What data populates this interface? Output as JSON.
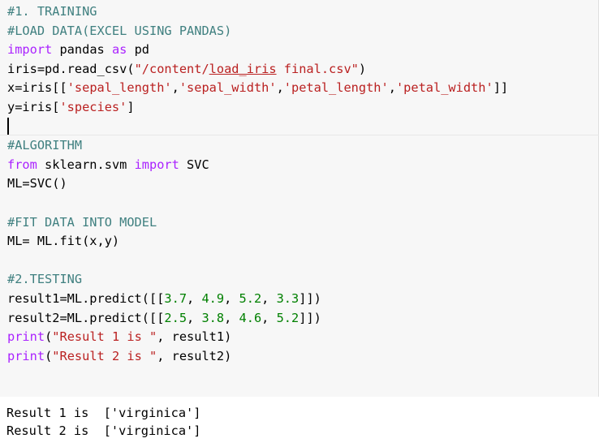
{
  "code_cell": {
    "comment_training": "#1. TRAINING",
    "comment_load": "#LOAD DATA(EXCEL USING PANDAS)",
    "kw_import": "import",
    "txt_pandas": " pandas ",
    "kw_as": "as",
    "txt_pd": " pd",
    "read_prefix": "iris=pd.read_csv(",
    "read_path_a": "\"/content/",
    "read_path_b": "load_iris",
    "read_path_c": " final.csv\"",
    "read_suffix": ")",
    "x_prefix": "x=iris[[",
    "col1": "'sepal_length'",
    "comma": ",",
    "col2": "'sepal_width'",
    "col3": "'petal_length'",
    "col4": "'petal_width'",
    "x_suffix": "]]",
    "y_prefix": "y=iris[",
    "y_col": "'species'",
    "y_suffix": "]",
    "comment_algorithm": "#ALGORITHM",
    "kw_from": "from",
    "txt_sklearn": " sklearn.svm ",
    "txt_svc": " SVC",
    "ml_svc": "ML=SVC()",
    "comment_fit": "#FIT DATA INTO MODEL",
    "ml_fit": "ML= ML.fit(x,y)",
    "comment_testing": "#2.TESTING",
    "r1_prefix": "result1=ML.predict([[",
    "r1_a": "3.7",
    "r1_b": "4.9",
    "r1_c": "5.2",
    "r1_d": "3.3",
    "r2_prefix": "result2=ML.predict([[",
    "r2_a": "2.5",
    "r2_b": "3.8",
    "r2_c": "4.6",
    "r2_d": "5.2",
    "num_sep": ", ",
    "predict_suffix": "]])",
    "kw_print": "print",
    "paren_open": "(",
    "str_result1": "\"Result 1 is \"",
    "str_result2": "\"Result 2 is \"",
    "arg_result1": ", result1)",
    "arg_result2": ", result2)"
  },
  "output": {
    "line1": "Result 1 is  ['virginica']",
    "line2": "Result 2 is  ['virginica']"
  }
}
